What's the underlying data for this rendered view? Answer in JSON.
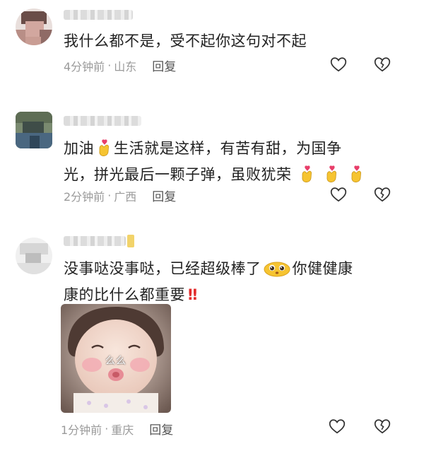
{
  "comments": [
    {
      "text": "我什么都不是，受不起你这句对不起",
      "time": "4分钟前",
      "location": "山东",
      "reply_label": "回复"
    },
    {
      "text_line1_a": "加油",
      "text_line1_b": "生活就是这样，有苦有甜，为国争",
      "text_line2": "光，拼光最后一颗子弹，虽败犹荣",
      "time": "2分钟前",
      "location": "广西",
      "reply_label": "回复"
    },
    {
      "text_line1_a": "没事哒没事哒，已经超级棒了",
      "text_line1_b": "你健健康",
      "text_line2": "康的比什么都重要",
      "exclaim": "‼",
      "photo_caption": "么么",
      "time": "1分钟前",
      "location": "重庆",
      "reply_label": "回复"
    }
  ],
  "icons": {
    "like": "heart-outline-icon",
    "dislike": "broken-heart-icon",
    "emoji_hands": "finger-heart-emoji",
    "emoji_face": "pleading-face-emoji"
  },
  "colors": {
    "emoji_yellow": "#f6c431",
    "exclaim_red": "#e22b2b",
    "meta_gray": "#9a9a9a"
  }
}
